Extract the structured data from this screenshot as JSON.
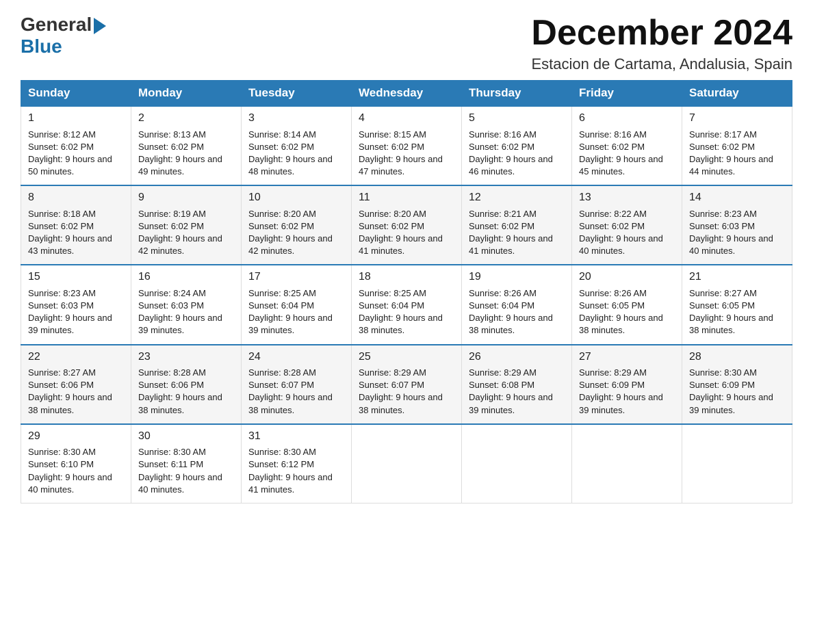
{
  "header": {
    "logo_general": "General",
    "logo_blue": "Blue",
    "month_title": "December 2024",
    "subtitle": "Estacion de Cartama, Andalusia, Spain"
  },
  "weekdays": [
    "Sunday",
    "Monday",
    "Tuesday",
    "Wednesday",
    "Thursday",
    "Friday",
    "Saturday"
  ],
  "weeks": [
    [
      {
        "day": "1",
        "sunrise": "8:12 AM",
        "sunset": "6:02 PM",
        "daylight": "9 hours and 50 minutes."
      },
      {
        "day": "2",
        "sunrise": "8:13 AM",
        "sunset": "6:02 PM",
        "daylight": "9 hours and 49 minutes."
      },
      {
        "day": "3",
        "sunrise": "8:14 AM",
        "sunset": "6:02 PM",
        "daylight": "9 hours and 48 minutes."
      },
      {
        "day": "4",
        "sunrise": "8:15 AM",
        "sunset": "6:02 PM",
        "daylight": "9 hours and 47 minutes."
      },
      {
        "day": "5",
        "sunrise": "8:16 AM",
        "sunset": "6:02 PM",
        "daylight": "9 hours and 46 minutes."
      },
      {
        "day": "6",
        "sunrise": "8:16 AM",
        "sunset": "6:02 PM",
        "daylight": "9 hours and 45 minutes."
      },
      {
        "day": "7",
        "sunrise": "8:17 AM",
        "sunset": "6:02 PM",
        "daylight": "9 hours and 44 minutes."
      }
    ],
    [
      {
        "day": "8",
        "sunrise": "8:18 AM",
        "sunset": "6:02 PM",
        "daylight": "9 hours and 43 minutes."
      },
      {
        "day": "9",
        "sunrise": "8:19 AM",
        "sunset": "6:02 PM",
        "daylight": "9 hours and 42 minutes."
      },
      {
        "day": "10",
        "sunrise": "8:20 AM",
        "sunset": "6:02 PM",
        "daylight": "9 hours and 42 minutes."
      },
      {
        "day": "11",
        "sunrise": "8:20 AM",
        "sunset": "6:02 PM",
        "daylight": "9 hours and 41 minutes."
      },
      {
        "day": "12",
        "sunrise": "8:21 AM",
        "sunset": "6:02 PM",
        "daylight": "9 hours and 41 minutes."
      },
      {
        "day": "13",
        "sunrise": "8:22 AM",
        "sunset": "6:02 PM",
        "daylight": "9 hours and 40 minutes."
      },
      {
        "day": "14",
        "sunrise": "8:23 AM",
        "sunset": "6:03 PM",
        "daylight": "9 hours and 40 minutes."
      }
    ],
    [
      {
        "day": "15",
        "sunrise": "8:23 AM",
        "sunset": "6:03 PM",
        "daylight": "9 hours and 39 minutes."
      },
      {
        "day": "16",
        "sunrise": "8:24 AM",
        "sunset": "6:03 PM",
        "daylight": "9 hours and 39 minutes."
      },
      {
        "day": "17",
        "sunrise": "8:25 AM",
        "sunset": "6:04 PM",
        "daylight": "9 hours and 39 minutes."
      },
      {
        "day": "18",
        "sunrise": "8:25 AM",
        "sunset": "6:04 PM",
        "daylight": "9 hours and 38 minutes."
      },
      {
        "day": "19",
        "sunrise": "8:26 AM",
        "sunset": "6:04 PM",
        "daylight": "9 hours and 38 minutes."
      },
      {
        "day": "20",
        "sunrise": "8:26 AM",
        "sunset": "6:05 PM",
        "daylight": "9 hours and 38 minutes."
      },
      {
        "day": "21",
        "sunrise": "8:27 AM",
        "sunset": "6:05 PM",
        "daylight": "9 hours and 38 minutes."
      }
    ],
    [
      {
        "day": "22",
        "sunrise": "8:27 AM",
        "sunset": "6:06 PM",
        "daylight": "9 hours and 38 minutes."
      },
      {
        "day": "23",
        "sunrise": "8:28 AM",
        "sunset": "6:06 PM",
        "daylight": "9 hours and 38 minutes."
      },
      {
        "day": "24",
        "sunrise": "8:28 AM",
        "sunset": "6:07 PM",
        "daylight": "9 hours and 38 minutes."
      },
      {
        "day": "25",
        "sunrise": "8:29 AM",
        "sunset": "6:07 PM",
        "daylight": "9 hours and 38 minutes."
      },
      {
        "day": "26",
        "sunrise": "8:29 AM",
        "sunset": "6:08 PM",
        "daylight": "9 hours and 39 minutes."
      },
      {
        "day": "27",
        "sunrise": "8:29 AM",
        "sunset": "6:09 PM",
        "daylight": "9 hours and 39 minutes."
      },
      {
        "day": "28",
        "sunrise": "8:30 AM",
        "sunset": "6:09 PM",
        "daylight": "9 hours and 39 minutes."
      }
    ],
    [
      {
        "day": "29",
        "sunrise": "8:30 AM",
        "sunset": "6:10 PM",
        "daylight": "9 hours and 40 minutes."
      },
      {
        "day": "30",
        "sunrise": "8:30 AM",
        "sunset": "6:11 PM",
        "daylight": "9 hours and 40 minutes."
      },
      {
        "day": "31",
        "sunrise": "8:30 AM",
        "sunset": "6:12 PM",
        "daylight": "9 hours and 41 minutes."
      },
      null,
      null,
      null,
      null
    ]
  ]
}
